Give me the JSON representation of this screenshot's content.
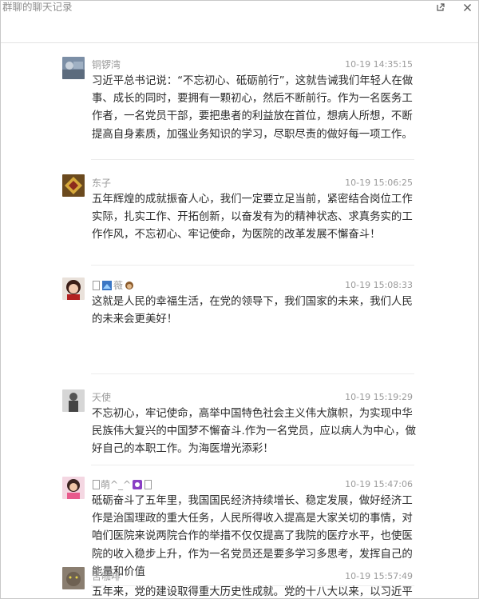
{
  "window": {
    "title": "群聊的聊天记录",
    "share_icon": "share-external-icon",
    "close_icon": "close-icon"
  },
  "messages": [
    {
      "sender": "铜锣湾",
      "time": "10-19 14:35:15",
      "text": "习近平总书记说：“不忘初心、砥砺前行”，这就告诫我们年轻人在做事、成长的同时，要拥有一颗初心，然后不断前行。作为一名医务工作者，一名党员干部，要把患者的利益放在首位，想病人所想，不断提高自身素质，加强业务知识的学习，尽职尽责的做好每一项工作。",
      "avatar": "photo-avatar-blue-gray"
    },
    {
      "sender": "东子",
      "time": "10-19 15:06:25",
      "text": "五年辉煌的成就振奋人心，我们一定要立足当前，紧密结合岗位工作实际，扎实工作、开拓创新，以奋发有为的精神状态、求真务实的工作作风，不忘初心、牢记使命，为医院的改革发展不懈奋斗！",
      "avatar": "photo-avatar-gold-emblem"
    },
    {
      "sender": "薇",
      "time": "10-19 15:08:33",
      "text": "这就是人民的幸福生活，在党的领导下，我们国家的未来，我们人民的未来会更美好！",
      "avatar": "photo-avatar-girl-red"
    },
    {
      "sender": "天使",
      "time": "10-19 15:19:29",
      "text": "不忘初心，牢记使命，高举中国特色社会主义伟大旗帜，为实现中华民族伟大复兴的中国梦不懈奋斗.作为一名党员，应以病人为中心，做好自己的本职工作。为海医增光添彩！",
      "avatar": "photo-avatar-person-gray"
    },
    {
      "sender": "萌^_^",
      "time": "10-19 15:47:06",
      "text": "砥砺奋斗了五年里，我国国民经济持续增长、稳定发展，做好经济工作是治国理政的重大任务，人民所得收入提高是大家关切的事情，对咱们医院来说两院合作的举措不仅仅提高了我院的医疗水平，也使医院的收入稳步上升，作为一名党员还是要多学习多思考，发挥自己的能量和价值",
      "avatar": "photo-avatar-girl-pink"
    },
    {
      "sender": "苦咖啡",
      "time": "10-19 15:57:49",
      "text": "五年来，党的建设取得重大历史性成就。党的十八大以来，以习近平同志为核心的党中央着眼进行伟大斗争、推进伟大事业、实",
      "avatar": "photo-avatar-cat"
    }
  ]
}
